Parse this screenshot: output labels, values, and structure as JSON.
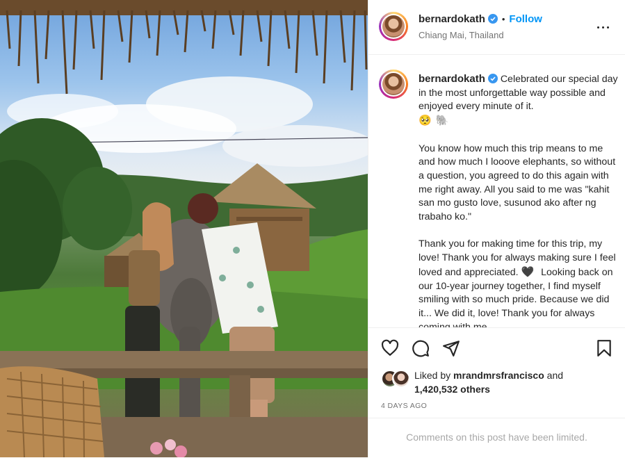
{
  "post": {
    "username": "bernardokath",
    "verified": true,
    "follow_label": "Follow",
    "separator": "•",
    "location": "Chiang Mai, Thailand",
    "more_options_icon": "more-horizontal-icon"
  },
  "caption": {
    "username": "bernardokath",
    "paragraph_1": "Celebrated our special day in the most unforgettable way possible and enjoyed every minute of it.",
    "emoji_1": "🥺",
    "emoji_2": "🐘",
    "paragraph_2": "You know how much this trip means to me and how much I looove elephants, so without a question, you agreed to do this again with me right away. All you said to me was \"kahit san mo gusto love, susunod ako after ng trabaho ko.\"",
    "paragraph_3": "Thank you for making time for this trip, my love! Thank you for always making sure I feel loved and appreciated.",
    "emoji_3": "🖤",
    "paragraph_3b": "Looking back on our 10-year journey together, I find myself smiling with so much pride. Because we did it... We did it, love! Thank you for always coming with me..."
  },
  "actions": {
    "like_icon": "heart-icon",
    "comment_icon": "comment-icon",
    "share_icon": "share-icon",
    "save_icon": "bookmark-icon"
  },
  "likes": {
    "prefix": "Liked by",
    "user": "mrandmrsfrancisco",
    "and": "and",
    "count": "1,420,532 others"
  },
  "timestamp": "4 DAYS AGO",
  "comments_notice": "Comments on this post have been limited.",
  "colors": {
    "link_blue": "#0095f6",
    "verified_blue": "#3897f0",
    "text": "#262626",
    "muted": "#737373",
    "disabled": "#a8a8a8"
  }
}
